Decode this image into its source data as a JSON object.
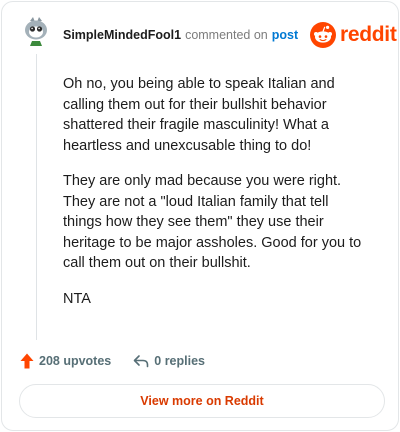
{
  "comment": {
    "author": "SimpleMindedFool1",
    "action_text": "commented on",
    "post_link": "post",
    "paragraphs": [
      "Oh no, you being able to speak Italian and calling them out for their bullshit behavior shattered their fragile masculinity! What a heartless and unexcusable thing to do!",
      "They are only mad because you were right. They are not a \"loud Italian family that tell things how they see them\" they use their heritage to be major assholes. Good for you to call them out on their bullshit.",
      "NTA"
    ]
  },
  "brand": {
    "wordmark": "reddit",
    "color": "#ff4500"
  },
  "actions": {
    "upvotes": "208 upvotes",
    "replies": "0 replies"
  },
  "footer": {
    "view_more": "View more on Reddit"
  },
  "icons": {
    "avatar": "snoo-avatar-icon",
    "logo": "reddit-logo-icon",
    "upvote": "upvote-arrow-icon",
    "reply": "reply-arrow-icon"
  }
}
